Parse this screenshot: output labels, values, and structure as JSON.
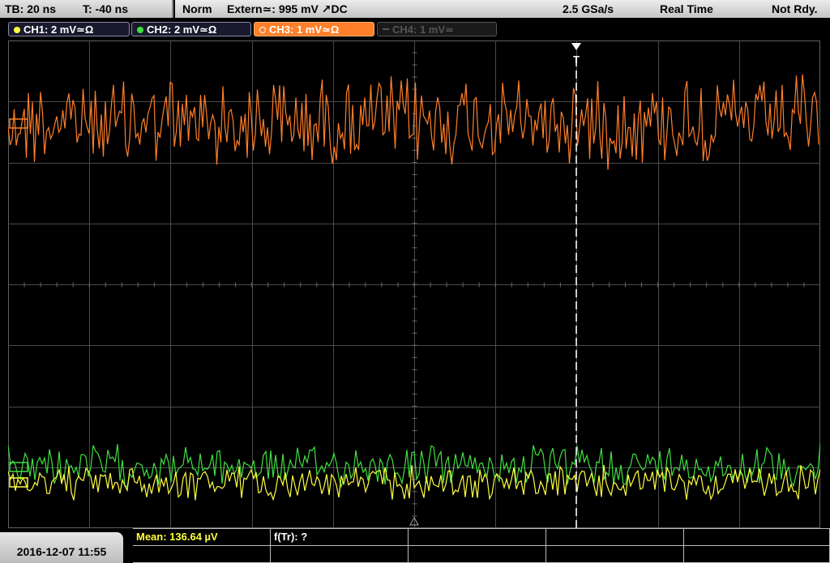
{
  "status": {
    "timebase": "TB: 20 ns",
    "trigger_offset": "T: -40 ns",
    "trigger_mode": "Norm",
    "trigger_source": "Extern≃: 995 mV ↗DC",
    "sample_rate": "2.5 GSa/s",
    "acq_mode": "Real Time",
    "state": "Not Rdy."
  },
  "channels": [
    {
      "label": "CH1: 2 mV≃Ω",
      "color": "#ffff40"
    },
    {
      "label": "CH2: 2 mV≃Ω",
      "color": "#40e040"
    },
    {
      "label": "CH3: 1 mV≃Ω",
      "color": "#ff7f2a"
    },
    {
      "label": "CH4: 1 mV≃",
      "color": "#606060"
    }
  ],
  "trigger_marker": "T",
  "measurements": {
    "mean": "Mean: 136.64 µV",
    "freq": "f(Tr): ?"
  },
  "datetime": "2016-12-07 11:55",
  "colors": {
    "grid": "#4a4a4a",
    "ch1": "#ffff40",
    "ch2": "#40e040",
    "ch3": "#ff7f2a"
  }
}
